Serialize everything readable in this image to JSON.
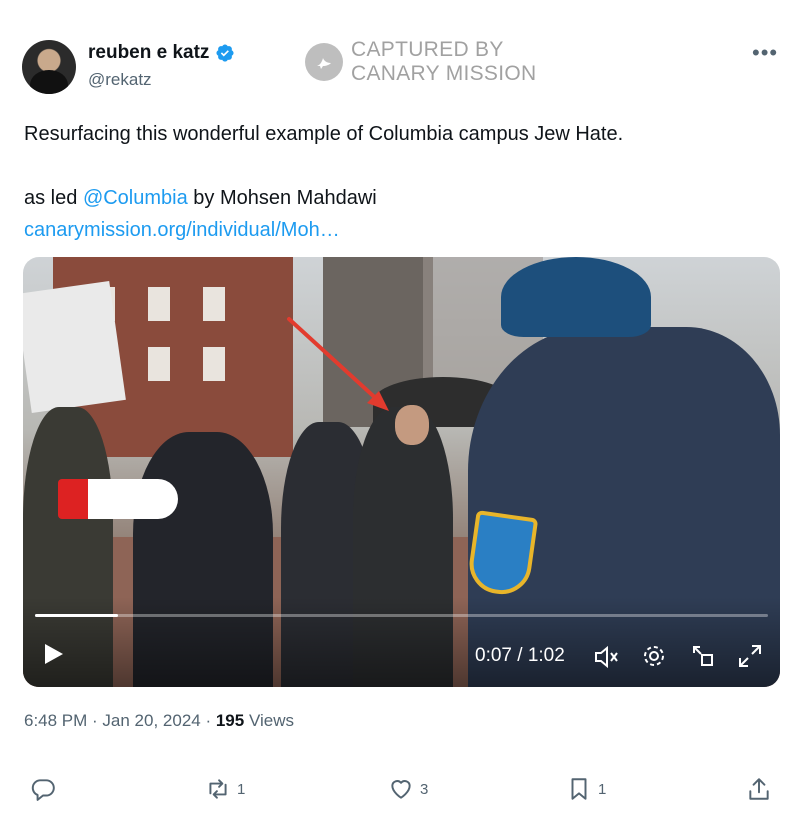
{
  "author": {
    "display_name": "reuben e katz",
    "handle": "@rekatz",
    "verified": true
  },
  "watermark": {
    "line1": "CAPTURED BY",
    "line2": "CANARY MISSION"
  },
  "tweet": {
    "line1": "Resurfacing this wonderful example of Columbia campus Jew Hate.",
    "line3_prefix": "as led ",
    "mention": "@Columbia",
    "line3_suffix": " by Mohsen Mahdawi",
    "url": "canarymission.org/individual/Moh…"
  },
  "video": {
    "time_display": "0:07 / 1:02",
    "progress": 0.113
  },
  "meta": {
    "time": "6:48 PM",
    "sep1": " · ",
    "date": "Jan 20, 2024",
    "sep2": " · ",
    "views_count": "195",
    "views_label": " Views"
  },
  "actions": {
    "reply_count": "",
    "retweet_count": "1",
    "like_count": "3",
    "bookmark_count": "1"
  },
  "colors": {
    "link": "#1d9bf0",
    "verified": "#1d9bf0",
    "muted": "#536471"
  },
  "icons": [
    "verified-badge-icon",
    "more-icon",
    "play-icon",
    "volume-icon",
    "settings-icon",
    "pip-icon",
    "fullscreen-icon",
    "reply-icon",
    "retweet-icon",
    "like-icon",
    "bookmark-icon",
    "share-icon",
    "canary-bird-icon"
  ]
}
